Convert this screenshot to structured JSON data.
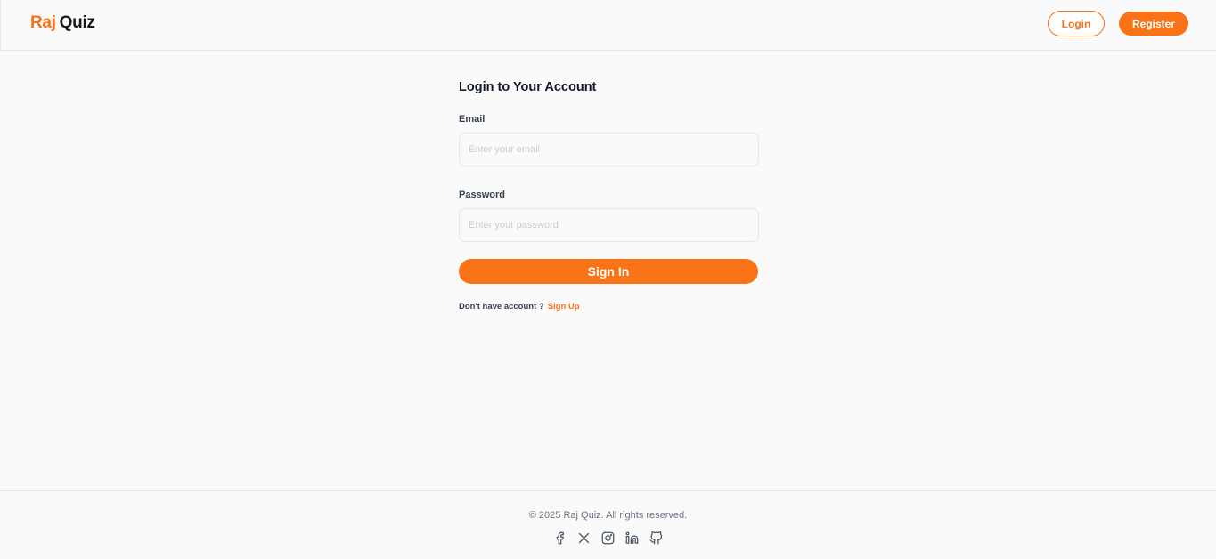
{
  "header": {
    "logo_part1": "Raj",
    "logo_part2": "Quiz",
    "login_label": "Login",
    "register_label": "Register"
  },
  "form": {
    "title": "Login to Your Account",
    "email_label": "Email",
    "email_placeholder": "Enter your email",
    "password_label": "Password",
    "password_placeholder": "Enter your password",
    "submit_label": "Sign In",
    "signup_prompt": "Don't have account ?",
    "signup_link": "Sign Up"
  },
  "footer": {
    "copyright": "© 2025 Raj Quiz. All rights reserved.",
    "socials": [
      "facebook-icon",
      "x-icon",
      "instagram-icon",
      "linkedin-icon",
      "github-icon"
    ]
  },
  "colors": {
    "accent": "#f97316",
    "background": "#fafafa",
    "border": "#e5e7eb"
  }
}
